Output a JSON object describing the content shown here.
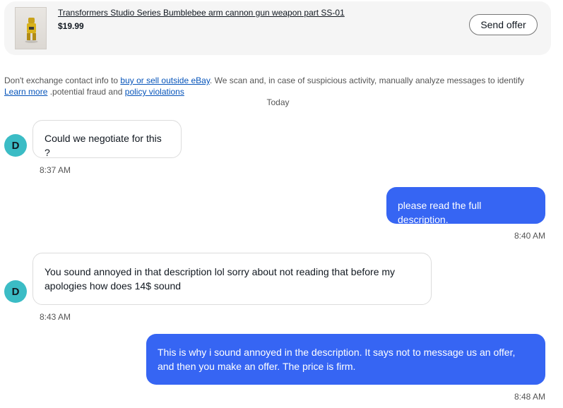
{
  "item": {
    "title": "Transformers Studio Series Bumblebee arm cannon gun weapon part SS-01",
    "price": "$19.99",
    "send_offer_label": "Send offer"
  },
  "disclaimer": {
    "prefix": "Don't exchange contact info to ",
    "link_outside": "buy or sell outside eBay",
    "middle": ". We scan and, in case of suspicious activity, manually analyze messages to identify",
    "learn_more": "Learn more",
    "suffix": " .potential fraud and ",
    "link_policy": "policy violations"
  },
  "date_separator": "Today",
  "messages": [
    {
      "from": "them",
      "avatar": "D",
      "text": "Could we negotiate for this ?",
      "time": "8:37 AM"
    },
    {
      "from": "me",
      "text": "please read the full description.",
      "time": "8:40 AM"
    },
    {
      "from": "them",
      "avatar": "D",
      "text": "You sound annoyed in that description lol sorry about not reading that before my apologies how does 14$ sound",
      "time": "8:43 AM"
    },
    {
      "from": "me",
      "text": "This is why i sound annoyed in the description. It says not to message us an offer, and then you make an offer. The price is firm.",
      "time": "8:48 AM"
    }
  ],
  "colors": {
    "accent": "#3665f3",
    "avatar": "#3bbcc5",
    "link": "#0654ba"
  }
}
